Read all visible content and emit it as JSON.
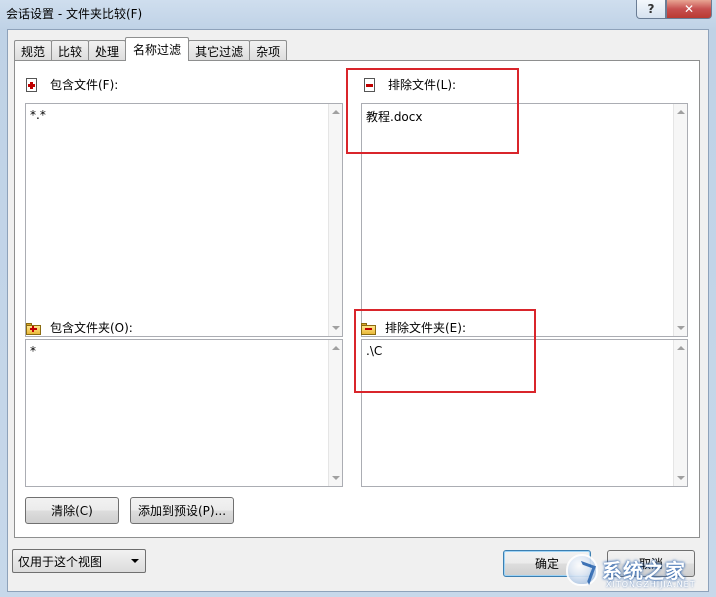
{
  "window": {
    "title": "会话设置 - 文件夹比较(F)",
    "help_label": "?",
    "close_label": "✕"
  },
  "tabs": [
    {
      "label": "规范"
    },
    {
      "label": "比较"
    },
    {
      "label": "处理"
    },
    {
      "label": "名称过滤",
      "active": true
    },
    {
      "label": "其它过滤"
    },
    {
      "label": "杂项"
    }
  ],
  "include_files": {
    "label": "包含文件(F):",
    "value": "*.*"
  },
  "exclude_files": {
    "label": "排除文件(L):",
    "value": "教程.docx"
  },
  "include_folders": {
    "label": "包含文件夹(O):",
    "value": "*"
  },
  "exclude_folders": {
    "label": "排除文件夹(E):",
    "value": ".\\C"
  },
  "buttons": {
    "clear": "清除(C)",
    "add_preset": "添加到预设(P)...",
    "ok": "确定",
    "cancel": "取消"
  },
  "scope_select": {
    "value": "仅用于这个视图"
  },
  "watermark": {
    "text": "系统之家",
    "sub": "XITONGZHIJIA.NET"
  },
  "colors": {
    "highlight_box": "#d9252b",
    "icon_red": "#c00000"
  }
}
